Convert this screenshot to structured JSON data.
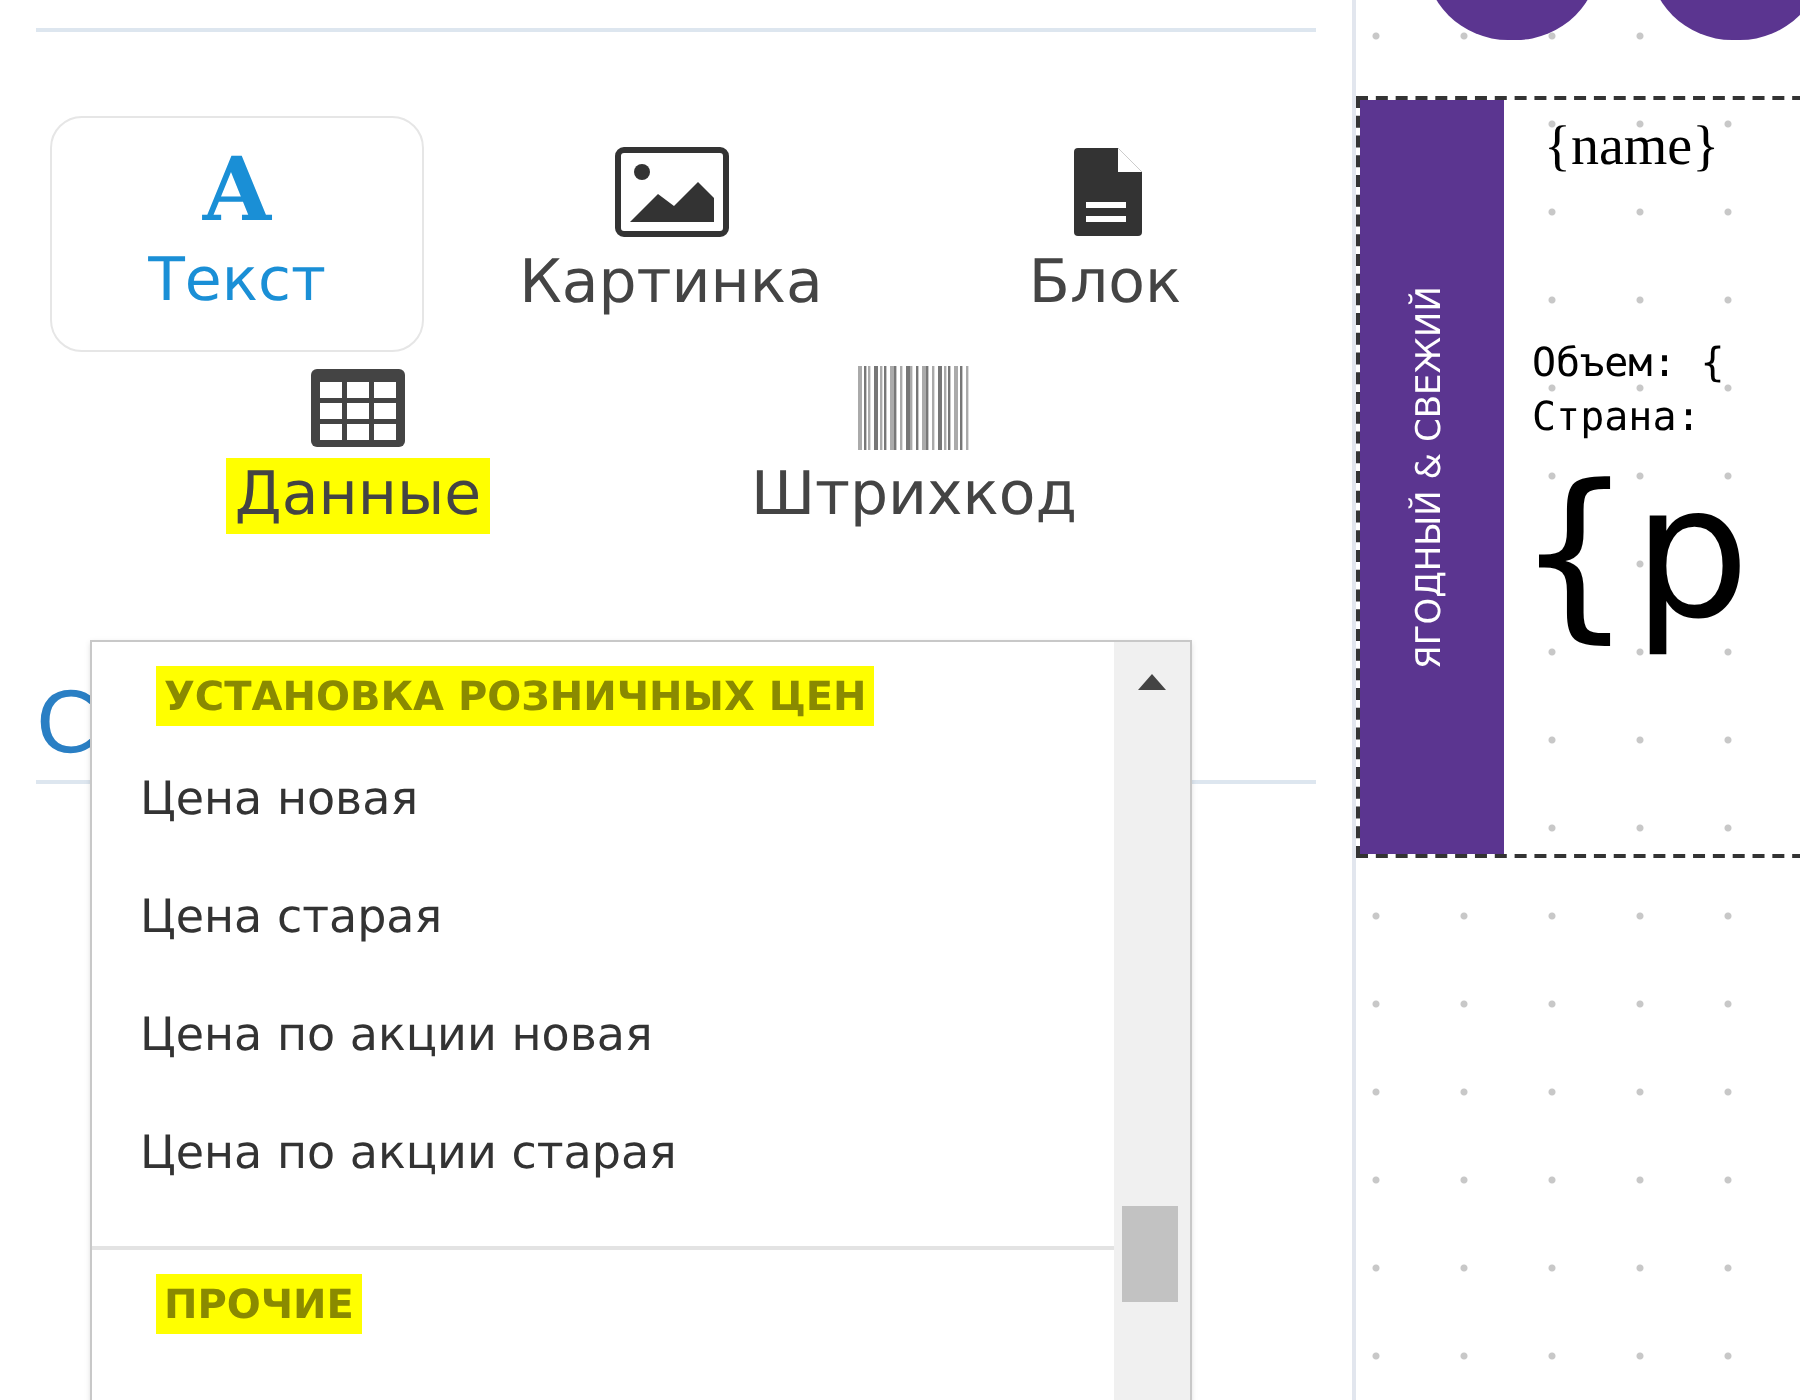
{
  "tools": [
    {
      "kind": "text",
      "icon_letter": "A",
      "label": "Текст",
      "selected": true,
      "highlighted": false
    },
    {
      "kind": "image",
      "label": "Картинка",
      "selected": false,
      "highlighted": false
    },
    {
      "kind": "block",
      "label": "Блок",
      "selected": false,
      "highlighted": false
    },
    {
      "kind": "data",
      "label": "Данные",
      "selected": false,
      "highlighted": true
    },
    {
      "kind": "barcode",
      "label": "Штрихкод",
      "selected": false,
      "highlighted": false
    }
  ],
  "section_heading": "С",
  "dropdown": {
    "groups": [
      {
        "title": "УСТАНОВКА РОЗНИЧНЫХ ЦЕН",
        "highlighted": true,
        "items": [
          "Цена новая",
          "Цена старая",
          "Цена по акции новая",
          "Цена по акции старая"
        ]
      },
      {
        "title": "ПРОЧИЕ",
        "highlighted": true
      }
    ]
  },
  "label_preview": {
    "side_text": "ЯГОДНЫЙ & СВЕЖИЙ",
    "name": "{name}",
    "lines": [
      "Объем: {",
      "Страна: "
    ],
    "price": "{p"
  }
}
